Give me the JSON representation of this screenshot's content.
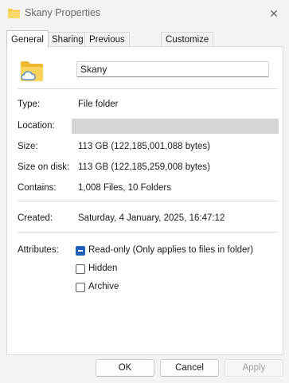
{
  "window": {
    "title": "Skany Properties",
    "close_glyph": "✕"
  },
  "tabs": [
    {
      "label": "General",
      "active": true
    },
    {
      "label": "Sharing",
      "active": false
    },
    {
      "label": "Previous Versions",
      "active": false
    },
    {
      "label": "Customize",
      "active": false
    }
  ],
  "general": {
    "folder_icon": "cloud-folder-icon",
    "name": "Skany",
    "type_label": "Type:",
    "type_value": "File folder",
    "location_label": "Location:",
    "size_label": "Size:",
    "size_value": "113 GB (122,185,001,088 bytes)",
    "size_on_disk_label": "Size on disk:",
    "size_on_disk_value": "113 GB (122,185,259,008 bytes)",
    "contains_label": "Contains:",
    "contains_value": "1,008 Files, 10 Folders",
    "created_label": "Created:",
    "created_value": "Saturday, 4 January, 2025, 16:47:12",
    "attributes_label": "Attributes:",
    "attributes": [
      {
        "label": "Read-only (Only applies to files in folder)",
        "state": "indeterminate"
      },
      {
        "label": "Hidden",
        "state": "unchecked"
      },
      {
        "label": "Archive",
        "state": "unchecked"
      }
    ]
  },
  "buttons": {
    "ok": "OK",
    "cancel": "Cancel",
    "apply": "Apply"
  },
  "colors": {
    "accent": "#1f5fb8",
    "folder": "#f6c94a"
  }
}
